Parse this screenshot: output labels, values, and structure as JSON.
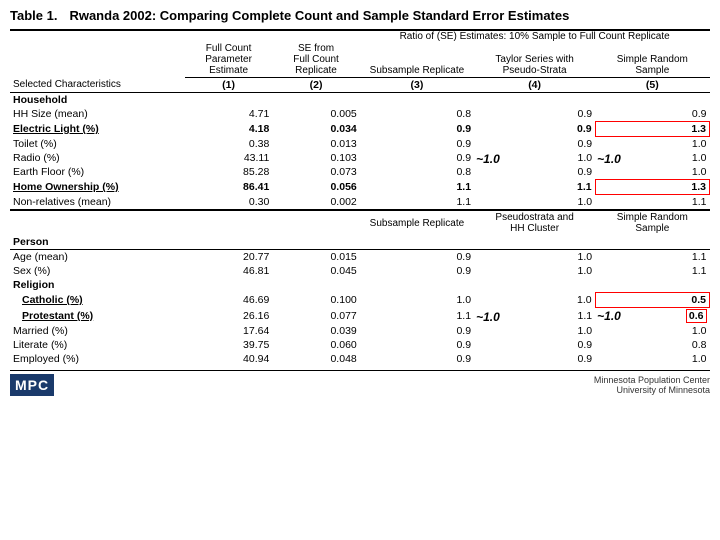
{
  "title": {
    "label": "Table 1.",
    "text": "Rwanda 2002:  Comparing Complete Count and Sample Standard Error Estimates"
  },
  "columns": {
    "col1": "Selected Characteristics",
    "col2_line1": "Full Count",
    "col2_line2": "Parameter",
    "col2_line3": "Estimate",
    "col3_line1": "SE from",
    "col3_line2": "Full Count",
    "col3_line3": "Replicate",
    "ratio_header": "Ratio of (SE) Estimates: 10% Sample to Full Count Replicate",
    "col4": "Subsample Replicate",
    "col5_line1": "Taylor Series with",
    "col5_line2": "Pseudo-Strata",
    "col6_line1": "Simple Random",
    "col6_line2": "Sample",
    "col_numbers": [
      "(1)",
      "(2)",
      "(3)",
      "(4)",
      "(5)"
    ],
    "col4_person": "Subsample Replicate",
    "col5_person_line1": "Pseudostrata and",
    "col5_person_line2": "HH Cluster",
    "col6_person_line1": "Simple Random",
    "col6_person_line2": "Sample"
  },
  "household_section": {
    "header": "Household",
    "rows": [
      {
        "label": "HH Size (mean)",
        "c1": "4.71",
        "c2": "0.005",
        "c3": "0.8",
        "c4": "0.9",
        "c5": "0.9",
        "bold": false,
        "c4_approx": false,
        "c5_approx": false,
        "bordered5": false
      },
      {
        "label": "Electric Light (%)",
        "c1": "4.18",
        "c2": "0.034",
        "c3": "0.9",
        "c4": "0.9",
        "c5": "1.3",
        "bold": true,
        "c4_approx": false,
        "c5_approx": false,
        "bordered5": true
      },
      {
        "label": "Toilet (%)",
        "c1": "0.38",
        "c2": "0.013",
        "c3": "0.9",
        "c4": "0.9",
        "c5": "1.0",
        "bold": false,
        "c4_approx": false,
        "c5_approx": false,
        "bordered5": false
      },
      {
        "label": "Radio (%)",
        "c1": "43.11",
        "c2": "0.103",
        "c3": "0.9",
        "c4_approx_val": "~1.0",
        "c4_approx": true,
        "c4": "1.0",
        "c5_approx_val": "~1.0",
        "c5_approx": true,
        "c5": "1.0",
        "bold": false,
        "bordered5": false
      },
      {
        "label": "Earth Floor (%)",
        "c1": "85.28",
        "c2": "0.073",
        "c3": "0.8",
        "c4": "0.9",
        "c5": "1.0",
        "bold": false,
        "c4_approx": false,
        "c5_approx": false,
        "bordered5": false
      },
      {
        "label": "Home Ownership (%)",
        "c1": "86.41",
        "c2": "0.056",
        "c3": "1.1",
        "c4": "1.1",
        "c5": "1.3",
        "bold": true,
        "c4_approx": false,
        "c5_approx": false,
        "bordered5": true
      },
      {
        "label": "Non-relatives (mean)",
        "c1": "0.30",
        "c2": "0.002",
        "c3": "1.1",
        "c4": "1.0",
        "c5": "1.1",
        "bold": false,
        "c4_approx": false,
        "c5_approx": false,
        "bordered5": false
      }
    ]
  },
  "person_section": {
    "header": "Person",
    "rows": [
      {
        "label": "Age (mean)",
        "c1": "20.77",
        "c2": "0.015",
        "c3": "0.9",
        "c4": "1.0",
        "c5": "1.1",
        "bold": false,
        "bordered5": false
      },
      {
        "label": "Sex (%)",
        "c1": "46.81",
        "c2": "0.045",
        "c3": "0.9",
        "c4": "1.0",
        "c5": "1.1",
        "bold": false,
        "bordered5": false
      }
    ],
    "religion_header": "Religion",
    "religion_rows": [
      {
        "label": "Catholic (%)",
        "c1": "46.69",
        "c2": "0.100",
        "c3": "1.0",
        "c4": "1.0",
        "c5": "0.5",
        "bold": true,
        "c4_approx": false,
        "c5_approx": false,
        "bordered5": true
      },
      {
        "label": "Protestant (%)",
        "c1": "26.16",
        "c2": "0.077",
        "c3": "1.1",
        "c4_approx_val": "~1.0",
        "c4_approx": true,
        "c4": "1.1",
        "c5_approx_val": "~1.0",
        "c5_approx": true,
        "c5": "0.6",
        "bold": true,
        "bordered5": true
      }
    ],
    "other_rows": [
      {
        "label": "Married (%)",
        "c1": "17.64",
        "c2": "0.039",
        "c3": "0.9",
        "c4": "1.0",
        "c5": "1.0",
        "bold": false,
        "bordered5": false
      },
      {
        "label": "Literate (%)",
        "c1": "39.75",
        "c2": "0.060",
        "c3": "0.9",
        "c4": "0.9",
        "c5": "0.8",
        "bold": false,
        "bordered5": false
      },
      {
        "label": "Employed (%)",
        "c1": "40.94",
        "c2": "0.048",
        "c3": "0.9",
        "c4": "0.9",
        "c5": "1.0",
        "bold": false,
        "bordered5": false
      }
    ]
  },
  "footer": {
    "mpc": "MPC",
    "umn_line1": "Minnesota Population Center",
    "umn_line2": "University of Minnesota"
  }
}
